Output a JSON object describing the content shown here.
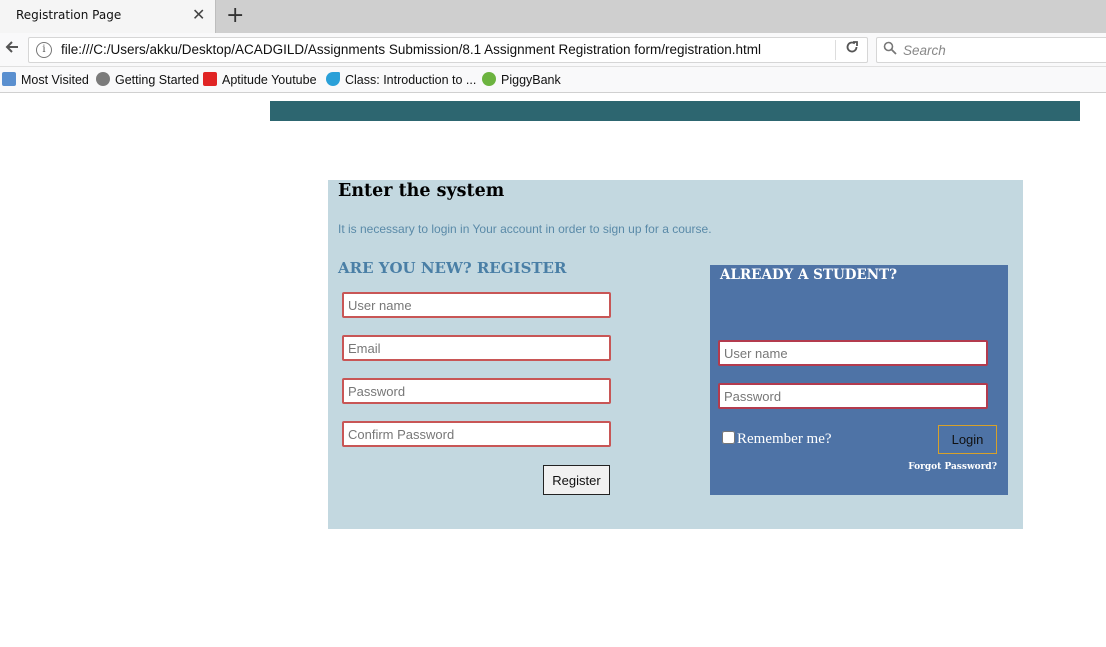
{
  "browser": {
    "tab_title": "Registration Page",
    "close_glyph": "✕",
    "new_tab_glyph": "+",
    "url": "file:///C:/Users/akku/Desktop/ACADGILD/Assignments Submission/8.1 Assignment Registration form/registration.html",
    "search_placeholder": "Search",
    "bookmarks": [
      {
        "label": "Most Visited",
        "icon": "most-visited-icon"
      },
      {
        "label": "Getting Started",
        "icon": "globe-icon"
      },
      {
        "label": "Aptitude Youtube",
        "icon": "youtube-icon"
      },
      {
        "label": "Class: Introduction to ...",
        "icon": "bird-icon"
      },
      {
        "label": "PiggyBank",
        "icon": "piggybank-icon"
      }
    ]
  },
  "colors": {
    "top_bar": "#2d6670",
    "panel_bg": "#c3d8e0",
    "login_bg": "#4e73a6",
    "field_border": "#c85656",
    "heading_blue": "#4a7fa6",
    "login_border": "#d7a12a"
  },
  "page": {
    "title": "Enter the system",
    "subtitle": "It is necessary to login in Your account in order to sign up for a course.",
    "register_heading": "ARE YOU NEW?  REGISTER",
    "register_fields": {
      "username_placeholder": "User name",
      "email_placeholder": "Email",
      "password_placeholder": "Password",
      "confirm_placeholder": "Confirm Password"
    },
    "register_button": "Register",
    "login": {
      "heading": "ALREADY A STUDENT?",
      "username_placeholder": "User name",
      "password_placeholder": "Password",
      "remember_label": "Remember me?",
      "login_button": "Login",
      "forgot_link": "Forgot Password?"
    }
  }
}
